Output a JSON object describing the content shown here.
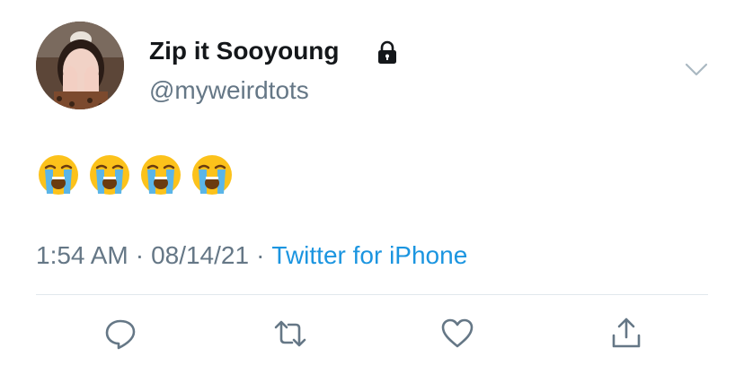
{
  "user": {
    "display_name": "Zip it Sooyoung",
    "handle": "@myweirdtots",
    "protected_icon": "lock-icon",
    "avatar_alt": "avatar"
  },
  "tweet": {
    "emojis": [
      "😭",
      "😭",
      "😭",
      "😭"
    ],
    "time": "1:54 AM",
    "separator": "·",
    "date": "08/14/21",
    "source": "Twitter for iPhone"
  },
  "actions": {
    "reply_icon": "reply-icon",
    "retweet_icon": "retweet-icon",
    "like_icon": "heart-icon",
    "share_icon": "share-icon",
    "menu_icon": "chevron-down-icon"
  },
  "colors": {
    "name": "#14171a",
    "secondary": "#657786",
    "link": "#1b95e0",
    "divider": "#e1e8ed",
    "icon": "#657786"
  }
}
